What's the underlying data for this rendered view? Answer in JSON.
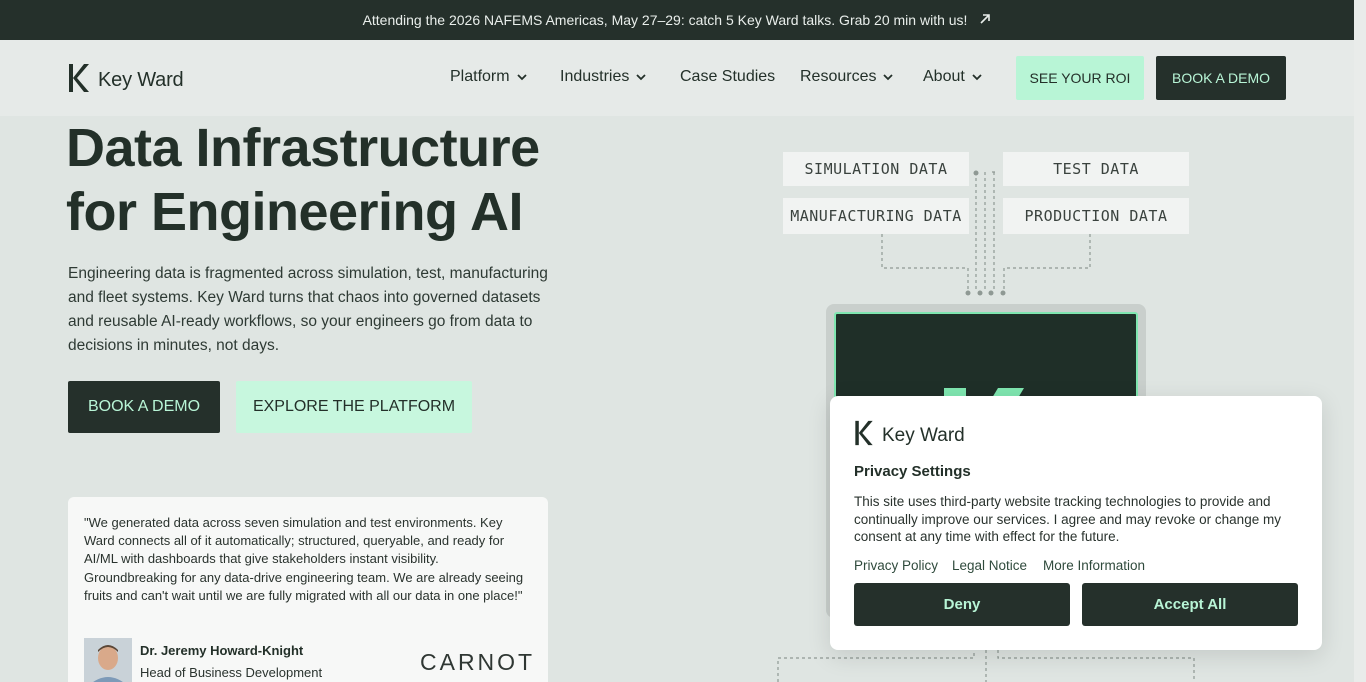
{
  "banner": {
    "text": "Attending the 2026 NAFEMS Americas, May 27–29: catch 5 Key Ward talks. Grab 20 min with us!",
    "arrow_icon": "arrow-up-right-icon"
  },
  "nav": {
    "logo_text": "Key Ward",
    "items": [
      {
        "label": "Platform",
        "has_dropdown": true
      },
      {
        "label": "Industries",
        "has_dropdown": true
      },
      {
        "label": "Case Studies",
        "has_dropdown": false
      },
      {
        "label": "Resources",
        "has_dropdown": true
      },
      {
        "label": "About",
        "has_dropdown": true
      }
    ],
    "roi_label": "SEE YOUR ROI",
    "demo_label": "BOOK A DEMO"
  },
  "hero": {
    "title_line1": "Data Infrastructure",
    "title_line2": "for Engineering AI",
    "description": "Engineering data is fragmented across simulation, test, manufacturing and fleet systems. Key Ward turns that chaos into governed datasets and reusable AI-ready workflows, so your engineers go from data to decisions in minutes, not days.",
    "demo_button": "BOOK A DEMO",
    "explore_button": "EXPLORE THE PLATFORM"
  },
  "testimonial": {
    "quote": "\"We generated data across seven simulation and test environments. Key Ward connects all of it automatically; structured, queryable, and ready for AI/ML with dashboards that give stakeholders instant visibility. Groundbreaking for any data-drive engineering team. We are already seeing fruits and can't wait until we are fully migrated with all our data in one place!\"",
    "author_name": "Dr. Jeremy Howard-Knight",
    "author_role": "Head of Business Development",
    "company_logo_text": "CARNOT"
  },
  "diagram": {
    "sources": [
      "SIMULATION DATA",
      "TEST DATA",
      "MANUFACTURING DATA",
      "PRODUCTION DATA"
    ]
  },
  "privacy": {
    "logo_text": "Key Ward",
    "title": "Privacy Settings",
    "text": "This site uses third-party website tracking technologies to provide and continually improve our services. I agree and may revoke or change my consent at any time with effect for the future.",
    "links": [
      "Privacy Policy",
      "Legal Notice",
      "More Information"
    ],
    "deny_label": "Deny",
    "accept_label": "Accept All"
  },
  "colors": {
    "dark": "#25302b",
    "mint": "#b8f5d6",
    "background": "#dfe5e2"
  }
}
